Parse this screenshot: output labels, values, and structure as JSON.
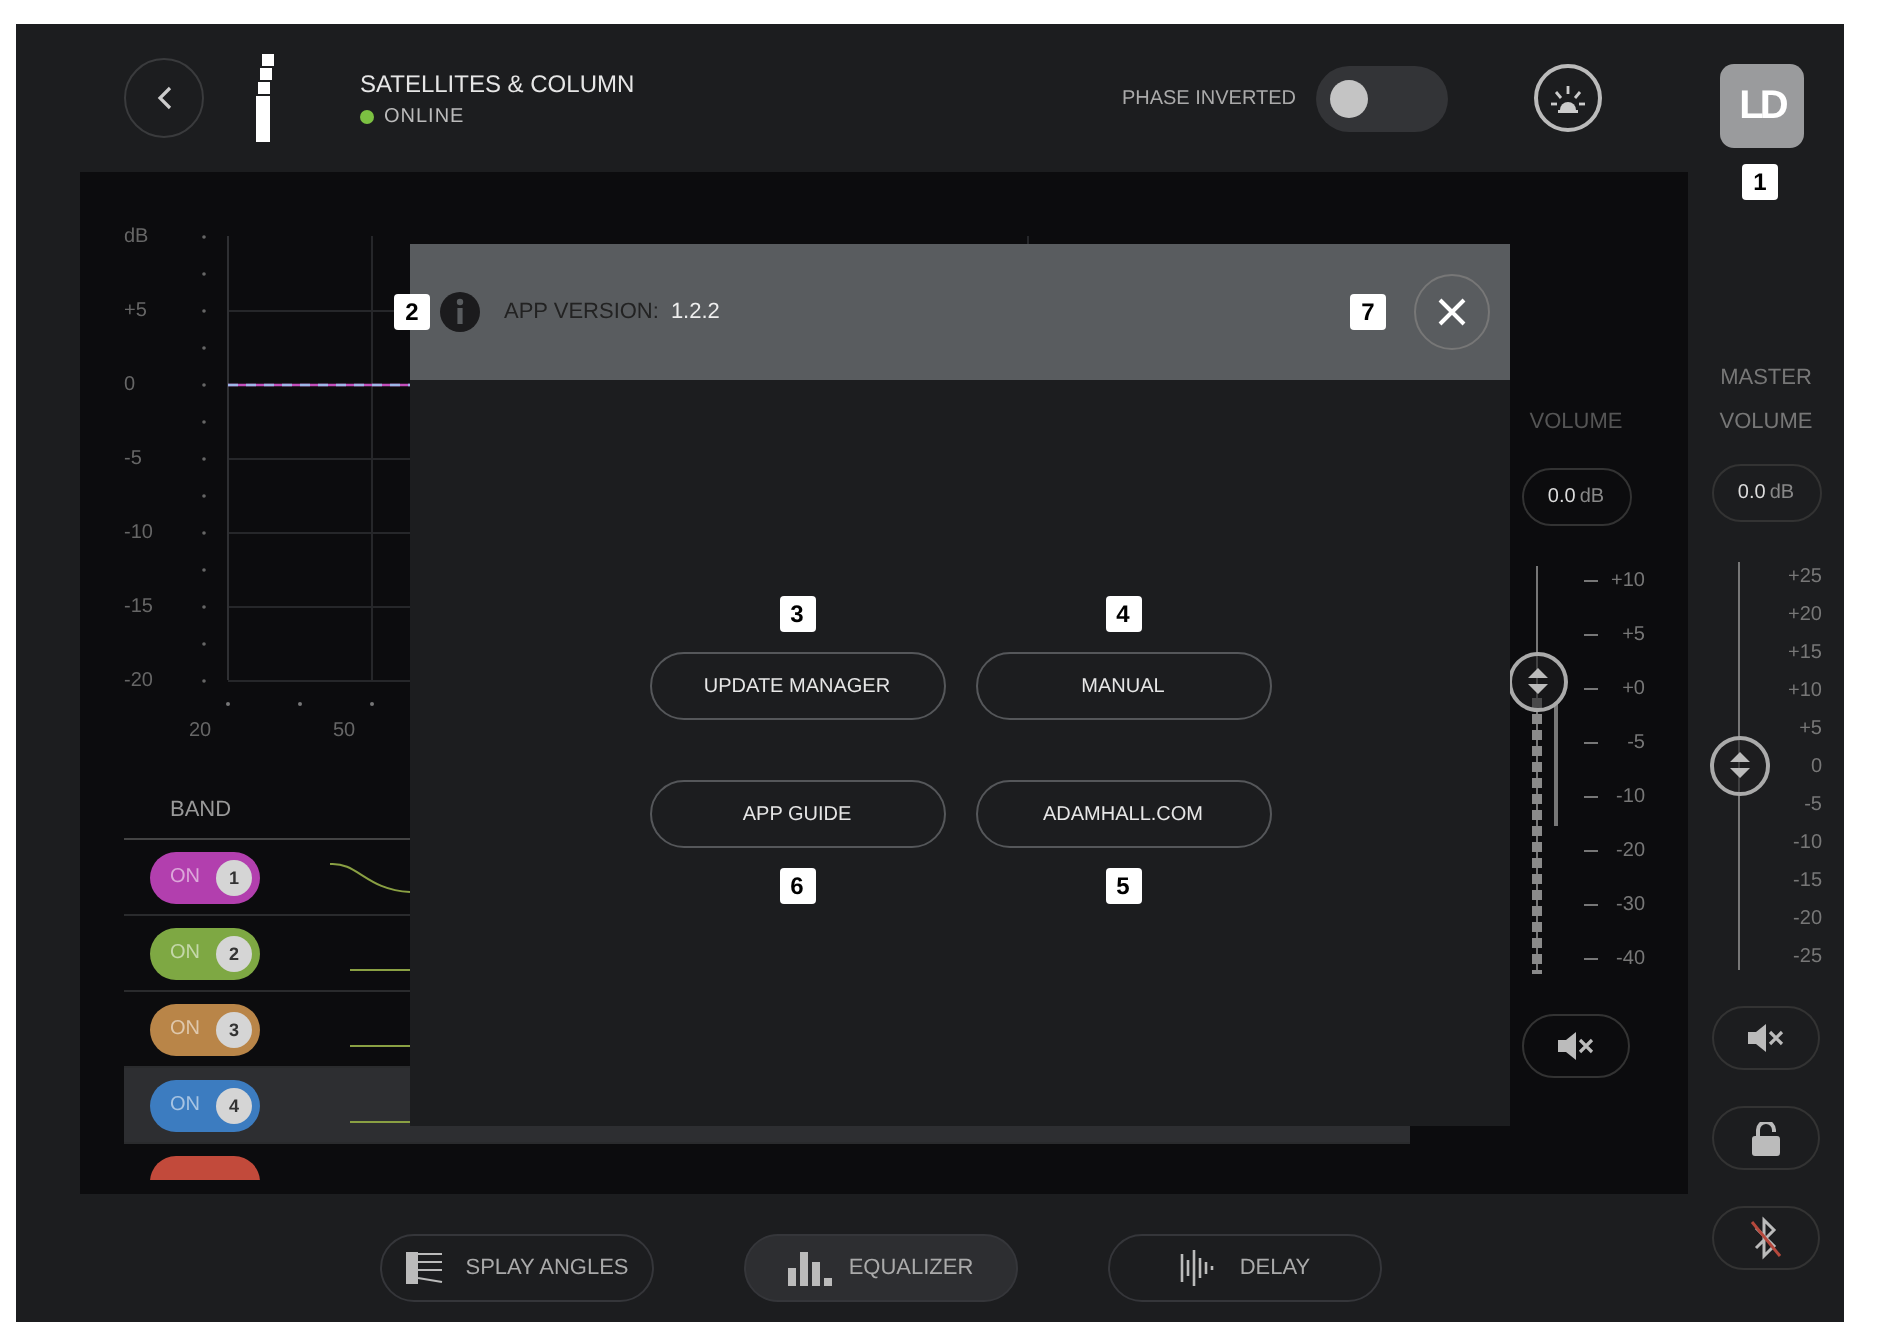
{
  "header": {
    "title": "SATELLITES & COLUMN",
    "status": {
      "label": "ONLINE",
      "color": "#7cc142"
    },
    "phase_inverted": {
      "label": "PHASE INVERTED",
      "on": false
    },
    "logo": "LD",
    "logo_badge": "1"
  },
  "eq_chart": {
    "y_labels": [
      "dB",
      "+5",
      "0",
      "-5",
      "-10",
      "-15",
      "-20"
    ],
    "x_labels": [
      "20",
      "50"
    ]
  },
  "bands": {
    "header": "BAND",
    "rows": [
      {
        "label": "ON",
        "number": "1",
        "color": "#b23fae",
        "selected": false
      },
      {
        "label": "ON",
        "number": "2",
        "color": "#7ea843",
        "selected": false
      },
      {
        "label": "ON",
        "number": "3",
        "color": "#b98548",
        "selected": false
      },
      {
        "label": "ON",
        "number": "4",
        "color": "#3c7cc0",
        "selected": true
      },
      {
        "color": "#c24a3b",
        "selected": false
      }
    ]
  },
  "volume": {
    "label": "VOLUME",
    "value": "0.0",
    "unit": "dB",
    "scale": [
      "+10",
      "+5",
      "+0",
      "-5",
      "-10",
      "-20",
      "-30",
      "-40"
    ],
    "level": 0.715,
    "meter": {
      "level": 0.675
    }
  },
  "master_volume": {
    "label": "MASTER VOLUME",
    "value": "0.0",
    "unit": "dB",
    "scale": [
      "+25",
      "+20",
      "+15",
      "+10",
      "+5",
      "0",
      "-5",
      "-10",
      "-15",
      "-20",
      "-25"
    ],
    "level": 0.5
  },
  "about_dialog": {
    "version_badge": "2",
    "version_label": "APP VERSION:",
    "version": "1.2.2",
    "close_badge": "7",
    "buttons": [
      {
        "label": "UPDATE MANAGER",
        "badge": "3"
      },
      {
        "label": "MANUAL",
        "badge": "4"
      },
      {
        "label": "APP GUIDE",
        "badge": "6"
      },
      {
        "label": "ADAMHALL.COM",
        "badge": "5"
      }
    ]
  },
  "footer_tabs": [
    {
      "label": "SPLAY ANGLES",
      "kind": "splay",
      "selected": false
    },
    {
      "label": "EQUALIZER",
      "kind": "equalizer",
      "selected": true
    },
    {
      "label": "DELAY",
      "kind": "delay",
      "selected": false
    }
  ]
}
